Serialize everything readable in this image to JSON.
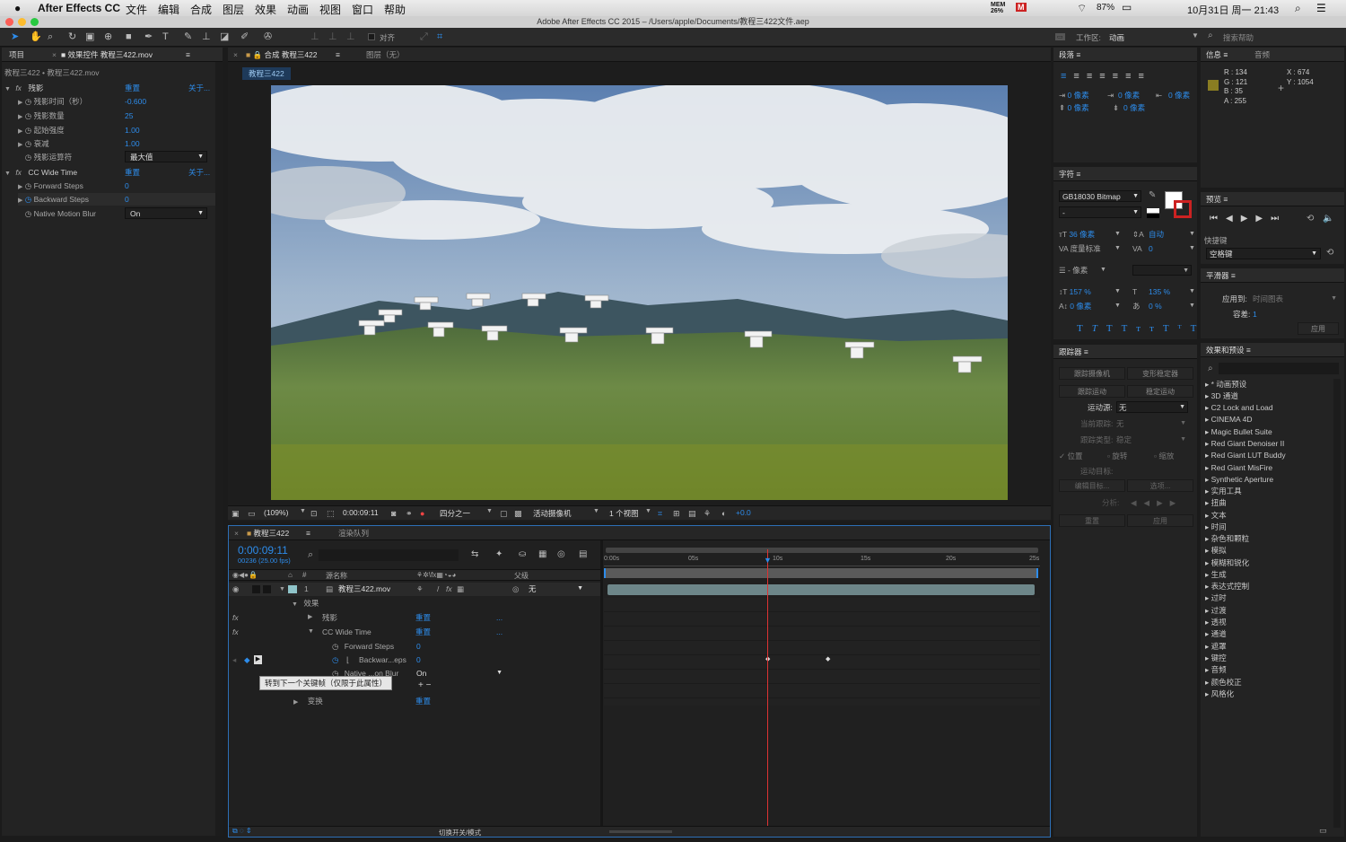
{
  "menubar": {
    "app": "After Effects CC",
    "items": [
      "文件",
      "编辑",
      "合成",
      "图层",
      "效果",
      "动画",
      "视图",
      "窗口",
      "帮助"
    ],
    "mem": "MEM",
    "mem_pct": "26%",
    "battery": "87%",
    "datetime": "10月31日 周一 21:43"
  },
  "window_title": "Adobe After Effects CC 2015 – /Users/apple/Documents/教程三422文件.aep",
  "toolbar": {
    "align_label": "对齐",
    "workspace_label": "工作区:",
    "workspace_value": "动画",
    "search_placeholder": "搜索帮助"
  },
  "project_panel": {
    "tab_project": "项目",
    "tab_effects": "效果控件 教程三422.mov",
    "breadcrumb": "教程三422 • 教程三422.mov",
    "effects": [
      {
        "name": "残影",
        "reset": "重置",
        "about": "关于...",
        "props": [
          {
            "label": "残影时间（秒）",
            "value": "-0.600"
          },
          {
            "label": "残影数量",
            "value": "25"
          },
          {
            "label": "起始强度",
            "value": "1.00"
          },
          {
            "label": "衰减",
            "value": "1.00"
          },
          {
            "label": "残影运算符",
            "value": "最大值"
          }
        ]
      },
      {
        "name": "CC Wide Time",
        "reset": "重置",
        "about": "关于...",
        "props": [
          {
            "label": "Forward Steps",
            "value": "0"
          },
          {
            "label": "Backward Steps",
            "value": "0"
          },
          {
            "label": "Native Motion Blur",
            "value": "On"
          }
        ]
      }
    ]
  },
  "comp_panel": {
    "tab_comp": "合成 教程三422",
    "tab_layer": "图层（无）",
    "comp_label": "教程三422",
    "zoom": "(109%)",
    "timecode": "0:00:09:11",
    "resolution": "四分之一",
    "camera": "活动摄像机",
    "views": "1 个视图",
    "exposure": "+0.0"
  },
  "timeline": {
    "tab": "教程三422",
    "tab_render": "渲染队列",
    "timecode": "0:00:09:11",
    "frames": "00236 (25.00 fps)",
    "col_source": "源名称",
    "col_parent": "父级",
    "layer_num": "1",
    "layer_name": "教程三422.mov",
    "parent_value": "无",
    "effects_label": "效果",
    "fx1": "残影",
    "fx2": "CC Wide Time",
    "reset": "重置",
    "forward": "Forward Steps",
    "forward_val": "0",
    "backward": "Backwar...eps",
    "backward_val": "0",
    "native": "Native ...on Blur",
    "native_val": "On",
    "transform": "变换",
    "tooltip": "转到下一个关键帧（仅限于此属性）",
    "ruler": [
      "0:00s",
      "05s",
      "10s",
      "15s",
      "20s",
      "25s"
    ],
    "bottom_toggle": "切换开关/模式"
  },
  "paragraph_panel": {
    "title": "段落",
    "values": [
      "0 像素",
      "0 像素",
      "0 像素",
      "0 像素",
      "0 像素"
    ]
  },
  "info_panel": {
    "title": "信息",
    "tab_audio": "音频",
    "r": "R : 134",
    "g": "G : 121",
    "b": "B : 35",
    "a": "A : 255",
    "x": "X : 674",
    "y": "Y : 1054",
    "swatch": "#8a7d22"
  },
  "character_panel": {
    "title": "字符",
    "font": "GB18030 Bitmap",
    "style": "-",
    "size": "36 像素",
    "leading": "自动",
    "kerning": "度量标准",
    "tracking": "0",
    "stroke": "- 像素",
    "vscale": "157 %",
    "hscale": "135 %",
    "baseline": "0 像素",
    "tsume": "0 %"
  },
  "preview_panel": {
    "title": "预览",
    "shortcut_label": "快捷键",
    "shortcut_value": "空格键"
  },
  "smoother_panel": {
    "title": "平滑器",
    "apply_to_label": "应用到:",
    "apply_to_value": "时间图表",
    "tolerance_label": "容差:",
    "tolerance_value": "1",
    "apply": "应用"
  },
  "tracker_panel": {
    "title": "跟踪器",
    "btn_track_camera": "跟踪摄像机",
    "btn_warp": "变形稳定器",
    "btn_track_motion": "跟踪运动",
    "btn_stabilize": "稳定运动",
    "source_label": "运动源:",
    "source_value": "无",
    "current_track_label": "当前跟踪:",
    "current_track_value": "无",
    "track_type_label": "跟踪类型:",
    "track_type_value": "稳定",
    "chk_position": "位置",
    "chk_rotation": "旋转",
    "chk_scale": "缩放",
    "target_label": "运动目标:",
    "edit_target": "编辑目标...",
    "options": "选项...",
    "analyze": "分析:",
    "reset": "重置",
    "apply": "应用"
  },
  "effects_presets": {
    "title": "效果和预设",
    "items": [
      "* 动画预设",
      "3D 通道",
      "C2 Lock and Load",
      "CINEMA 4D",
      "Magic Bullet Suite",
      "Red Giant Denoiser II",
      "Red Giant LUT Buddy",
      "Red Giant MisFire",
      "Synthetic Aperture",
      "实用工具",
      "扭曲",
      "文本",
      "时间",
      "杂色和颗粒",
      "模拟",
      "模糊和锐化",
      "生成",
      "表达式控制",
      "过时",
      "过渡",
      "透视",
      "通道",
      "遮罩",
      "键控",
      "音频",
      "颜色校正",
      "风格化"
    ]
  }
}
